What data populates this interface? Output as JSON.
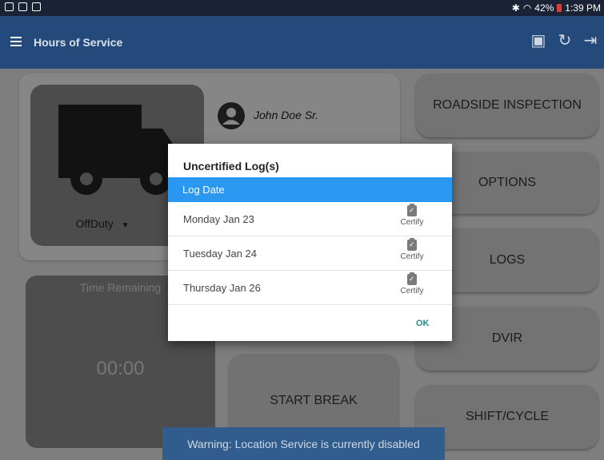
{
  "status_bar": {
    "battery": "42%",
    "time": "1:39 PM"
  },
  "app_bar": {
    "title": "Hours of Service",
    "icons": [
      "menu-icon",
      "printer-icon",
      "refresh-icon",
      "logout-icon"
    ]
  },
  "driver": {
    "name": "John Doe Sr.",
    "duty_status": "OffDuty"
  },
  "time_panel": {
    "label": "Time Remaining",
    "value": "00:00"
  },
  "buttons": {
    "roadside": "ROADSIDE INSPECTION",
    "options": "OPTIONS",
    "logs": "LOGS",
    "dvir": "DVIR",
    "shift_cycle": "SHIFT/CYCLE",
    "start_break": "START BREAK"
  },
  "toast": "Warning: Location Service is currently disabled",
  "dialog": {
    "title": "Uncertified Log(s)",
    "column_header": "Log Date",
    "rows": [
      {
        "date": "Monday Jan 23",
        "action": "Certify"
      },
      {
        "date": "Tuesday Jan 24",
        "action": "Certify"
      },
      {
        "date": "Thursday Jan 26",
        "action": "Certify"
      }
    ],
    "ok_label": "OK"
  }
}
